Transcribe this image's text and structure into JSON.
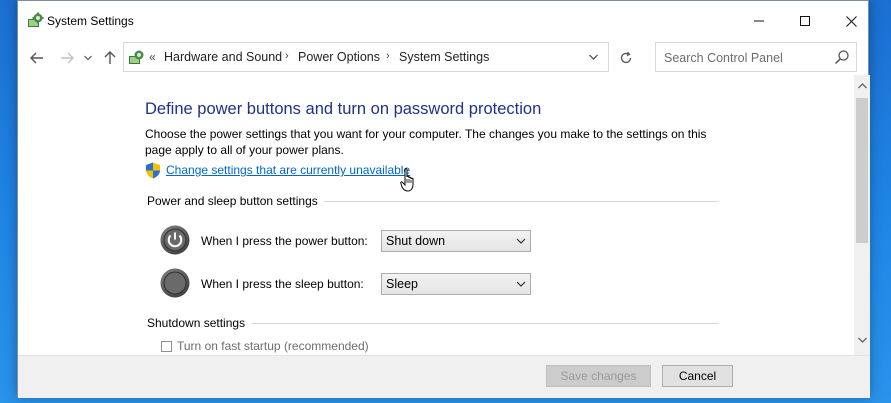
{
  "window": {
    "title": "System Settings",
    "icon": "control-panel-icon"
  },
  "nav": {
    "breadcrumb_prefix": "«",
    "breadcrumbs": [
      "Hardware and Sound",
      "Power Options",
      "System Settings"
    ],
    "separator": "›"
  },
  "search": {
    "placeholder": "Search Control Panel"
  },
  "main": {
    "heading": "Define power buttons and turn on password protection",
    "description": "Choose the power settings that you want for your computer. The changes you make to the settings on this page apply to all of your power plans.",
    "link_text": "Change settings that are currently unavailable",
    "sections": {
      "power_sleep_title": "Power and sleep button settings",
      "shutdown_title": "Shutdown settings"
    },
    "rows": [
      {
        "label": "When I press the power button:",
        "value": "Shut down",
        "icon": "power-button-icon"
      },
      {
        "label": "When I press the sleep button:",
        "value": "Sleep",
        "icon": "sleep-button-icon"
      }
    ],
    "shutdown_items": [
      {
        "label": "Turn on fast startup (recommended)"
      }
    ]
  },
  "footer": {
    "save_label": "Save changes",
    "cancel_label": "Cancel"
  },
  "colors": {
    "heading": "#1e3287",
    "link": "#0066cc",
    "desktop": "#1f86e6"
  }
}
